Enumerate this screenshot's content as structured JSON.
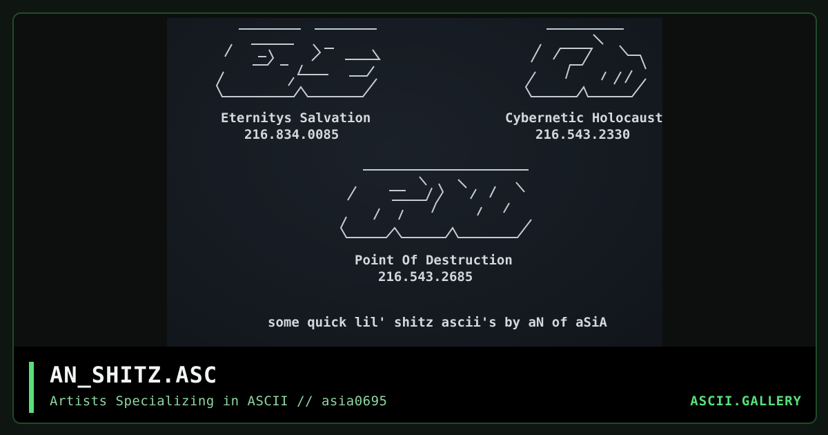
{
  "art": {
    "logo1": " __________     __________\n/  ______  \\   \\_____     \\\n/  / _)__  /    /  ____  __/\n/  /  /  /\\____/  /___/  /\n\\__/___/  /\\______/___/  /\n   \\______/^\\__________/",
    "logo2": " ________    ______\n/  ____  \\   \\__  \\\n/  /  /  /  /  / __\\\n/  /  /  /  /  /  /\n\\_____/^\\__/___/\n        \\______/",
    "logo3": " ______________________________\n/    ______   \\     \\      \\\n/    / ____//  /  /  /  /  /\n/    /  /  /  /  /  /  /  /\n/    /  /  /  /  /  /  /  /\n\\___/^\\____/^\\_______/"
  },
  "groups": [
    {
      "name": "Eternitys Salvation",
      "number": "216.834.0085"
    },
    {
      "name": "Cybernetic Holocaust",
      "number": "216.543.2330"
    },
    {
      "name": "Point Of Destruction",
      "number": "216.543.2685"
    }
  ],
  "signature": "some quick lil' shitz ascii's by aN of aSiA",
  "footer": {
    "title": "AN_SHITZ.ASC",
    "subtitle": "Artists Specializing in ASCII // asia0695",
    "brand": "ASCII.GALLERY"
  }
}
